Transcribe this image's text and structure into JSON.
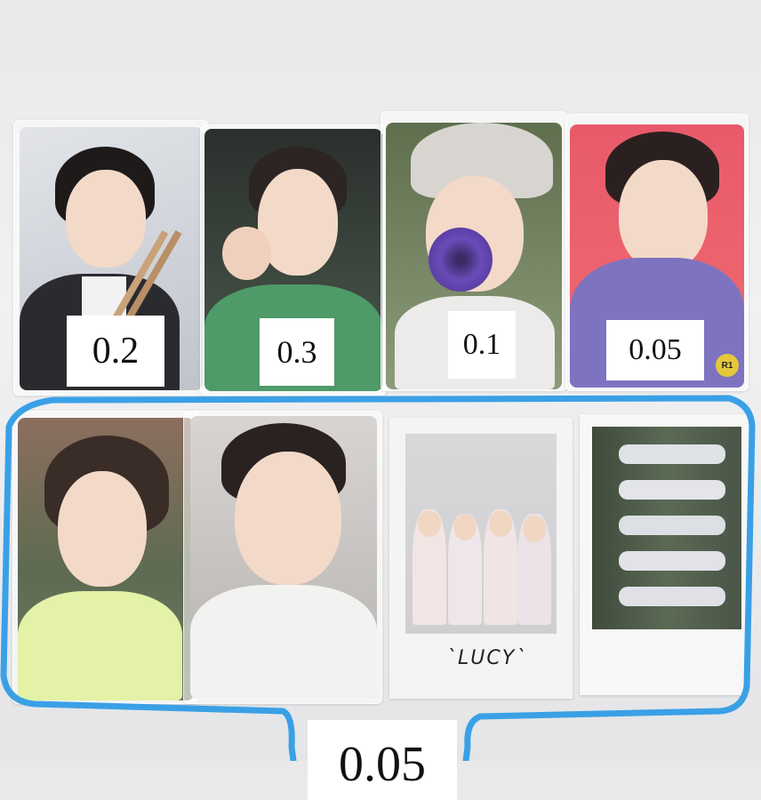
{
  "cards": [
    {
      "price": "0.2"
    },
    {
      "price": "0.3"
    },
    {
      "price": "0.1"
    },
    {
      "price": "0.05"
    }
  ],
  "bottom_price": "0.05",
  "polaroid_caption": "`LUCY`",
  "badge": "R1",
  "colors": {
    "highlight_outline": "#3aa0e6",
    "label_bg": "#ffffff"
  }
}
